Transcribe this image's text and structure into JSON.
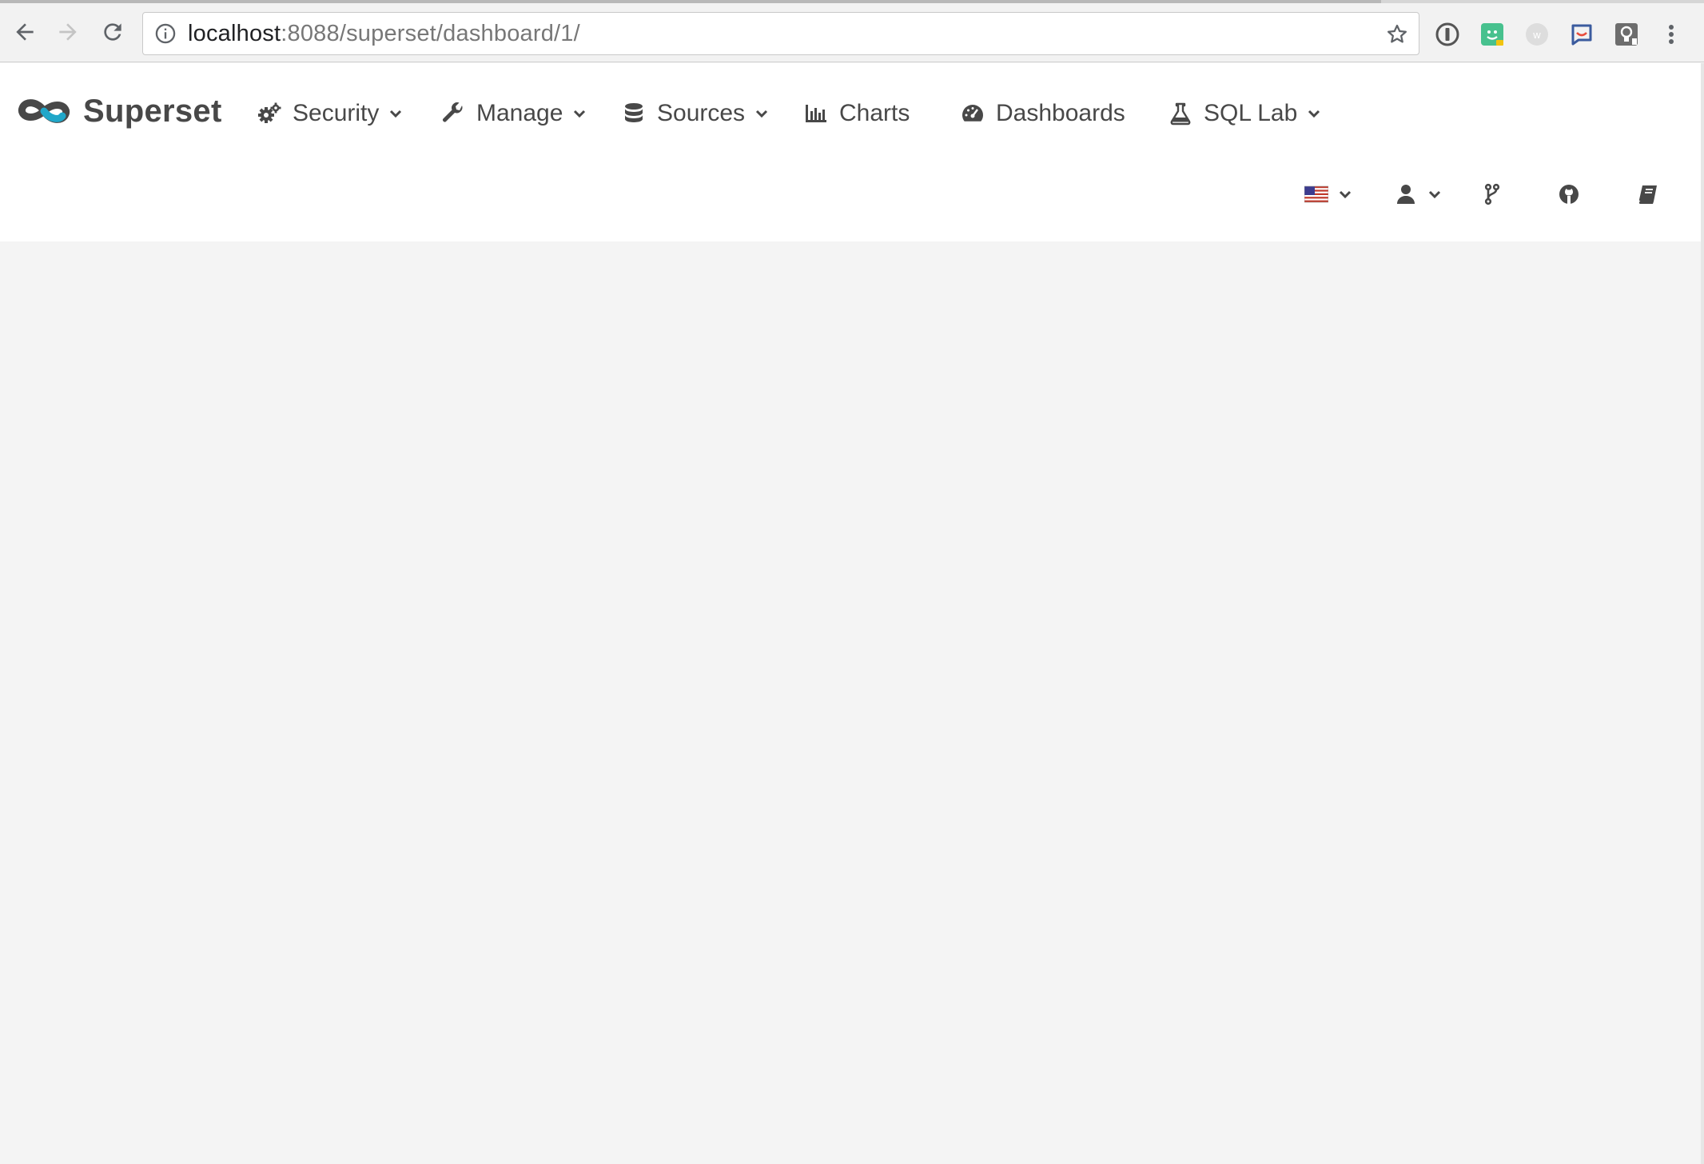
{
  "browser": {
    "url_host": "localhost",
    "url_path": ":8088/superset/dashboard/1/",
    "icons": {
      "back": "arrow-left-icon",
      "forward": "arrow-right-icon",
      "reload": "reload-icon",
      "info": "info-circle-icon",
      "bookmark": "star-icon",
      "menu": "vertical-dots-icon"
    },
    "extensions": [
      "1password-icon",
      "grammarly-icon",
      "wappalyzer-icon",
      "intercom-icon",
      "lightbulb-icon"
    ]
  },
  "navbar": {
    "brand": "Superset",
    "menu": [
      {
        "label": "Security",
        "icon": "gears-icon",
        "dropdown": true
      },
      {
        "label": "Manage",
        "icon": "wrench-icon",
        "dropdown": true
      },
      {
        "label": "Sources",
        "icon": "database-icon",
        "dropdown": true
      },
      {
        "label": "Charts",
        "icon": "bar-chart-icon",
        "dropdown": false
      },
      {
        "label": "Dashboards",
        "icon": "dashboard-icon",
        "dropdown": false
      },
      {
        "label": "SQL Lab",
        "icon": "flask-icon",
        "dropdown": true
      }
    ],
    "right": [
      {
        "name": "language",
        "icon": "us-flag-icon",
        "dropdown": true
      },
      {
        "name": "user",
        "icon": "user-icon",
        "dropdown": true
      },
      {
        "name": "version",
        "icon": "code-fork-icon",
        "dropdown": false
      },
      {
        "name": "github",
        "icon": "github-icon",
        "dropdown": false
      },
      {
        "name": "docs",
        "icon": "book-icon",
        "dropdown": false
      }
    ]
  },
  "colors": {
    "brand_teal": "#20a7c9",
    "brand_dark": "#484848",
    "page_bg": "#f4f4f4",
    "navbar_bg": "#ffffff"
  }
}
